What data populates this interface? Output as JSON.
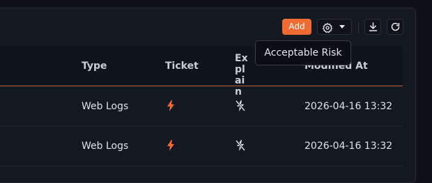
{
  "toolbar": {
    "add_label": "Add",
    "icons": [
      "gear-icon",
      "chevron-down-icon",
      "download-icon",
      "refresh-icon"
    ]
  },
  "table": {
    "columns": [
      "Type",
      "Ticket",
      "Explain",
      "Modified At"
    ],
    "rows": [
      {
        "type": "Web Logs",
        "ticket_icon": "bolt-icon",
        "explain_icon": "bolt-off-icon",
        "modified_at": "2026-04-16 13:32"
      },
      {
        "type": "Web Logs",
        "ticket_icon": "bolt-icon",
        "explain_icon": "bolt-off-icon",
        "modified_at": "2026-04-16 13:32"
      }
    ]
  },
  "tooltip": {
    "text": "Acceptable Risk"
  },
  "colors": {
    "accent": "#f06b34",
    "background": "#0d1018",
    "panel": "#141821"
  }
}
